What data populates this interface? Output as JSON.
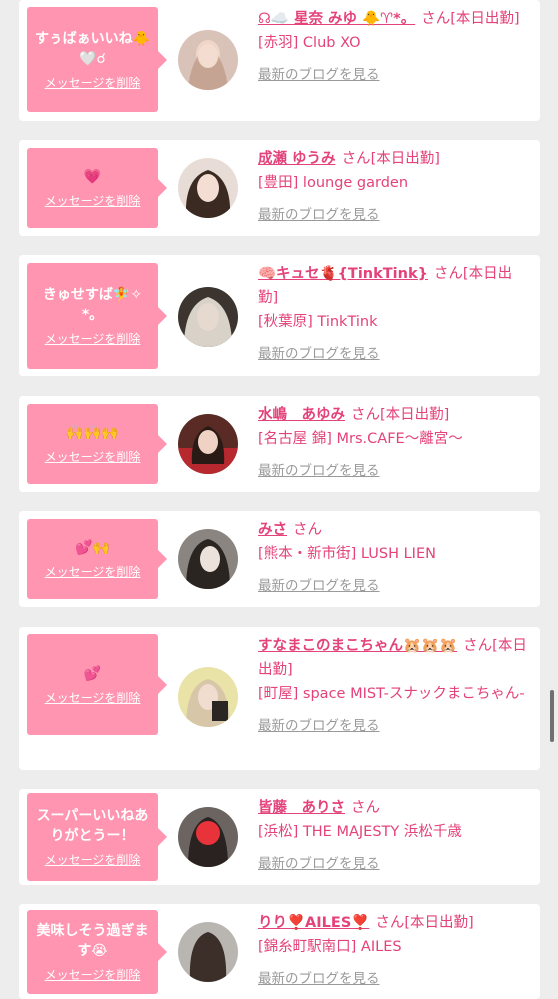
{
  "delete_label": "メッセージを削除",
  "blog_label": "最新のブログを見る",
  "honorific": "さん",
  "cards": [
    {
      "message": "すぅばぁいいね🐥🤍☌",
      "name": "☊☁️ 星奈 みゆ 🐥♈︎*。",
      "status": "[本日出勤]",
      "shop": "[赤羽] Club XO"
    },
    {
      "message": "💗",
      "name": "成瀬 ゆうみ",
      "status": "[本日出勤]",
      "shop": "[豊田] lounge garden"
    },
    {
      "message": "きゅせすば🧚✧*。",
      "name": "🧠キュセ🫀{TinkTink}",
      "status": "[本日出勤]",
      "shop": "[秋葉原] TinkTink"
    },
    {
      "message": "🙌🙌🙌",
      "name": "水嶋　あゆみ",
      "status": "[本日出勤]",
      "shop": "[名古屋 錦] Mrs.CAFE〜離宮〜"
    },
    {
      "message": "💕🙌",
      "name": "みさ",
      "status": "",
      "shop": "[熊本・新市街] LUSH LIEN"
    },
    {
      "message": "💕",
      "name": "すなまこのまこちゃん🐹🐹🐹",
      "status": "[本日出勤]",
      "shop": "[町屋] space MIST-スナックまこちゃん-"
    },
    {
      "message": "スーパーいいねありがとうー！",
      "name": "皆藤　ありさ",
      "status": "",
      "shop": "[浜松] THE MAJESTY 浜松千歳"
    },
    {
      "message": "美味しそう過ぎます😭",
      "name": "りり❣️AILES❣️",
      "status": "[本日出勤]",
      "shop": "[錦糸町駅南口] AILES"
    }
  ]
}
